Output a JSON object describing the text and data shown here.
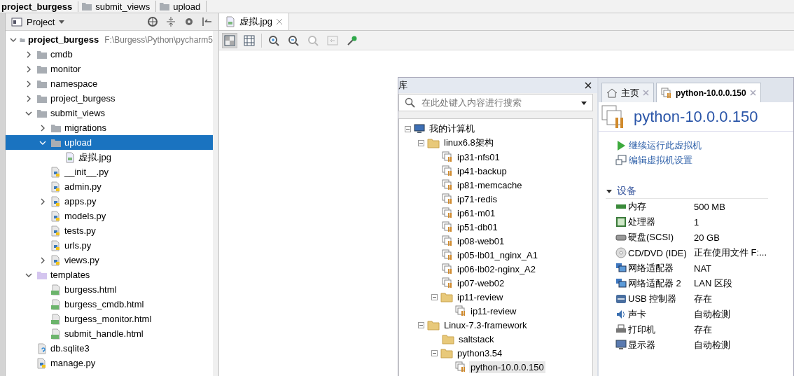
{
  "breadcrumbs": [
    "project_burgess",
    "submit_views",
    "upload"
  ],
  "project": {
    "title": "Project",
    "tree": [
      {
        "label": "project_burgess",
        "path": "F:\\Burgess\\Python\\pycharm5",
        "kind": "root",
        "expanded": true,
        "selected": false,
        "children": [
          {
            "label": "cmdb",
            "kind": "folder",
            "expanded": false,
            "selected": false
          },
          {
            "label": "monitor",
            "kind": "folder",
            "expanded": false,
            "selected": false
          },
          {
            "label": "namespace",
            "kind": "folder",
            "expanded": false,
            "selected": false
          },
          {
            "label": "project_burgess",
            "kind": "folder",
            "expanded": false,
            "selected": false
          },
          {
            "label": "submit_views",
            "kind": "folder",
            "expanded": true,
            "selected": false,
            "children": [
              {
                "label": "migrations",
                "kind": "folder",
                "expanded": false,
                "selected": false
              },
              {
                "label": "upload",
                "kind": "folder",
                "expanded": true,
                "selected": true,
                "children": [
                  {
                    "label": "虚拟.jpg",
                    "kind": "image",
                    "selected": false
                  }
                ]
              },
              {
                "label": "__init__.py",
                "kind": "python",
                "selected": false
              },
              {
                "label": "admin.py",
                "kind": "python",
                "selected": false
              },
              {
                "label": "apps.py",
                "kind": "python",
                "expanded": false,
                "selected": false
              },
              {
                "label": "models.py",
                "kind": "python",
                "selected": false
              },
              {
                "label": "tests.py",
                "kind": "python",
                "selected": false
              },
              {
                "label": "urls.py",
                "kind": "python",
                "selected": false
              },
              {
                "label": "views.py",
                "kind": "python",
                "expanded": false,
                "selected": false
              }
            ]
          },
          {
            "label": "templates",
            "kind": "templates",
            "expanded": true,
            "selected": false,
            "children": [
              {
                "label": "burgess.html",
                "kind": "html",
                "selected": false
              },
              {
                "label": "burgess_cmdb.html",
                "kind": "html",
                "selected": false
              },
              {
                "label": "burgess_monitor.html",
                "kind": "html",
                "selected": false
              },
              {
                "label": "submit_handle.html",
                "kind": "html",
                "selected": false
              }
            ]
          },
          {
            "label": "db.sqlite3",
            "kind": "unknown",
            "selected": false
          },
          {
            "label": "manage.py",
            "kind": "python",
            "selected": false
          }
        ]
      }
    ]
  },
  "editor": {
    "tabs": [
      {
        "label": "虚拟.jpg",
        "selected": true
      }
    ]
  },
  "image": {
    "library": {
      "title": "库",
      "search": {
        "placeholder": "在此处键入内容进行搜索"
      },
      "tree": [
        {
          "label": "我的计算机",
          "kind": "computer",
          "expanded": true,
          "selected": false,
          "children": [
            {
              "label": "linux6.8架构",
              "kind": "folder",
              "expanded": true,
              "selected": false,
              "children": [
                {
                  "label": "ip31-nfs01",
                  "kind": "vm",
                  "selected": false
                },
                {
                  "label": "ip41-backup",
                  "kind": "vm",
                  "selected": false
                },
                {
                  "label": "ip81-memcache",
                  "kind": "vm",
                  "selected": false
                },
                {
                  "label": "ip71-redis",
                  "kind": "vm",
                  "selected": false
                },
                {
                  "label": "ip61-m01",
                  "kind": "vm",
                  "selected": false
                },
                {
                  "label": "ip51-db01",
                  "kind": "vm",
                  "selected": false
                },
                {
                  "label": "ip08-web01",
                  "kind": "vm",
                  "selected": false
                },
                {
                  "label": "ip05-lb01_nginx_A1",
                  "kind": "vm",
                  "selected": false
                },
                {
                  "label": "ip06-lb02-nginx_A2",
                  "kind": "vm",
                  "selected": false
                },
                {
                  "label": "ip07-web02",
                  "kind": "vm",
                  "selected": false
                },
                {
                  "label": "ip11-review",
                  "kind": "folder",
                  "expanded": true,
                  "selected": false,
                  "children": [
                    {
                      "label": "ip11-review",
                      "kind": "vm",
                      "selected": false
                    }
                  ]
                }
              ]
            },
            {
              "label": "Linux-7.3-framework",
              "kind": "folder",
              "expanded": true,
              "selected": false,
              "children": [
                {
                  "label": "saltstack",
                  "kind": "folder",
                  "selected": false
                },
                {
                  "label": "python3.54",
                  "kind": "folder",
                  "expanded": true,
                  "selected": false,
                  "children": [
                    {
                      "label": "python-10.0.0.150",
                      "kind": "vm",
                      "selected": true
                    }
                  ]
                }
              ]
            }
          ]
        }
      ]
    },
    "detail": {
      "tabs": [
        {
          "label": "主页",
          "kind": "home",
          "selected": false
        },
        {
          "label": "python-10.0.0.150",
          "kind": "vm",
          "selected": true
        }
      ],
      "title": "python-10.0.0.150",
      "actions": [
        {
          "kind": "play",
          "label": "继续运行此虚拟机"
        },
        {
          "kind": "edit",
          "label": "编辑虚拟机设置"
        }
      ],
      "devices": {
        "title": "设备",
        "expanded": true,
        "items": [
          {
            "kind": "memory",
            "name": "内存",
            "value": "500 MB"
          },
          {
            "kind": "cpu",
            "name": "处理器",
            "value": "1"
          },
          {
            "kind": "disk",
            "name": "硬盘(SCSI)",
            "value": "20 GB"
          },
          {
            "kind": "cd",
            "name": "CD/DVD (IDE)",
            "value": "正在使用文件 F:..."
          },
          {
            "kind": "network",
            "name": "网络适配器",
            "value": "NAT"
          },
          {
            "kind": "network",
            "name": "网络适配器 2",
            "value": "LAN 区段"
          },
          {
            "kind": "usb",
            "name": "USB 控制器",
            "value": "存在"
          },
          {
            "kind": "sound",
            "name": "声卡",
            "value": "自动检测"
          },
          {
            "kind": "printer",
            "name": "打印机",
            "value": "存在"
          },
          {
            "kind": "display",
            "name": "显示器",
            "value": "自动检测"
          }
        ]
      }
    }
  }
}
